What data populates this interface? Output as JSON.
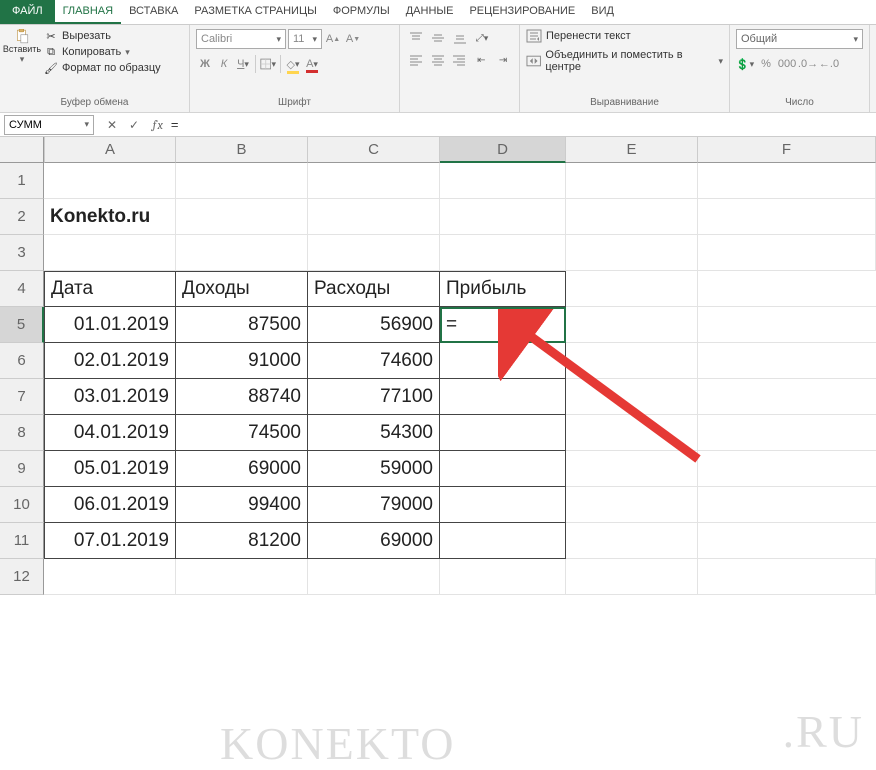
{
  "tabs": {
    "file": "ФАЙЛ",
    "items": [
      "ГЛАВНАЯ",
      "ВСТАВКА",
      "РАЗМЕТКА СТРАНИЦЫ",
      "ФОРМУЛЫ",
      "ДАННЫЕ",
      "РЕЦЕНЗИРОВАНИЕ",
      "ВИД"
    ],
    "active_index": 0
  },
  "ribbon": {
    "clipboard": {
      "paste": "Вставить",
      "cut": "Вырезать",
      "copy": "Копировать",
      "format_painter": "Формат по образцу",
      "label": "Буфер обмена"
    },
    "font": {
      "name": "Calibri",
      "size": "11",
      "label": "Шрифт"
    },
    "alignment": {
      "wrap": "Перенести текст",
      "merge": "Объединить и поместить в центре",
      "label": "Выравнивание"
    },
    "number": {
      "format": "Общий",
      "label": "Число"
    }
  },
  "formula_bar": {
    "name_box": "СУММ",
    "value": "="
  },
  "columns": [
    "A",
    "B",
    "C",
    "D",
    "E",
    "F"
  ],
  "active_col_index": 3,
  "row_headers": [
    1,
    2,
    3,
    4,
    5,
    6,
    7,
    8,
    9,
    10,
    11,
    12
  ],
  "active_row_index": 4,
  "active_cell_value": "=",
  "cells": {
    "A2": "Konekto.ru",
    "A4": "Дата",
    "B4": "Доходы",
    "C4": "Расходы",
    "D4": "Прибыль",
    "A5": "01.01.2019",
    "B5": "87500",
    "C5": "56900",
    "A6": "02.01.2019",
    "B6": "91000",
    "C6": "74600",
    "A7": "03.01.2019",
    "B7": "88740",
    "C7": "77100",
    "A8": "04.01.2019",
    "B8": "74500",
    "C8": "54300",
    "A9": "05.01.2019",
    "B9": "69000",
    "C9": "59000",
    "A10": "06.01.2019",
    "B10": "99400",
    "C10": "79000",
    "A11": "07.01.2019",
    "B11": "81200",
    "C11": "69000"
  },
  "watermark": "KONEKTO",
  "watermark2": ".RU"
}
